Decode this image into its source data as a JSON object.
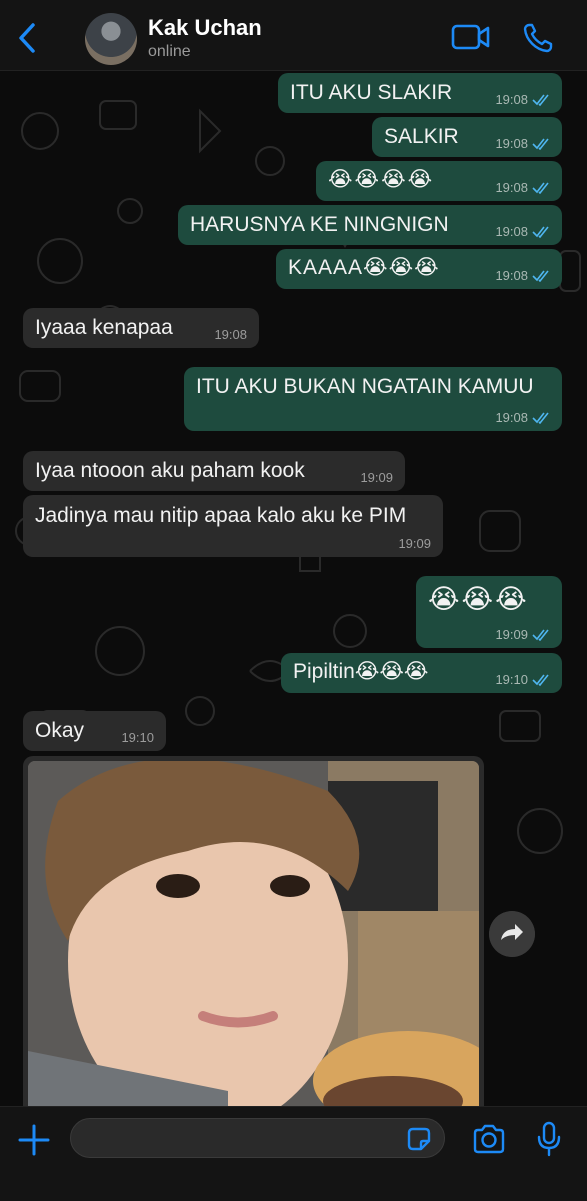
{
  "header": {
    "contact_name": "Kak Uchan",
    "status": "online",
    "back_icon": "chevron-left-icon",
    "video_icon": "video-camera-icon",
    "phone_icon": "phone-icon"
  },
  "colors": {
    "accent": "#1d8af6",
    "outgoing_bubble": "#1e4b3e",
    "incoming_bubble": "#2b2b2b",
    "read_ticks": "#4fb6f0"
  },
  "messages": [
    {
      "direction": "out",
      "text": "ITU AKU SLAKIR",
      "time": "19:08",
      "read": true
    },
    {
      "direction": "out",
      "text": "SALKIR",
      "time": "19:08",
      "read": true
    },
    {
      "direction": "out",
      "text": "😭😭😭😭",
      "time": "19:08",
      "read": true
    },
    {
      "direction": "out",
      "text": "HARUSNYA KE NINGNIGN",
      "time": "19:08",
      "read": true
    },
    {
      "direction": "out",
      "text": "KAAAA😭😭😭",
      "time": "19:08",
      "read": true
    },
    {
      "direction": "in",
      "text": "Iyaaa kenapaa",
      "time": "19:08"
    },
    {
      "direction": "out",
      "text": "ITU AKU BUKAN NGATAIN KAMUU",
      "time": "19:08",
      "read": true
    },
    {
      "direction": "in",
      "text": "Iyaa ntooon aku paham kook",
      "time": "19:09"
    },
    {
      "direction": "in",
      "text": "Jadinya mau nitip apaa kalo aku ke PIM",
      "time": "19:09"
    },
    {
      "direction": "out",
      "text": "😭😭😭",
      "time": "19:09",
      "read": true
    },
    {
      "direction": "out",
      "text": "Pipiltin😭😭😭",
      "time": "19:10",
      "read": true
    },
    {
      "direction": "in",
      "text": "Okay",
      "time": "19:10"
    }
  ],
  "photo_message": {
    "direction": "in",
    "content": "selfie-photo"
  },
  "forward_icon": "forward-arrow-icon",
  "composer": {
    "placeholder": "",
    "plus_icon": "plus-icon",
    "sticker_icon": "sticker-icon",
    "camera_icon": "camera-icon",
    "mic_icon": "microphone-icon"
  }
}
